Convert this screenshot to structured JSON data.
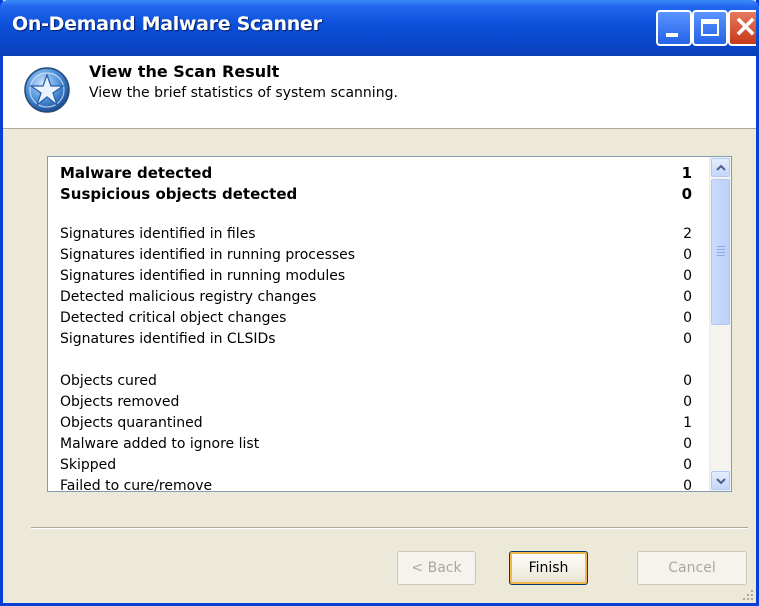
{
  "window": {
    "title": "On-Demand Malware Scanner"
  },
  "header": {
    "title": "View the Scan Result",
    "subtitle": "View the brief statistics of system scanning."
  },
  "stats": {
    "summary": [
      {
        "label": "Malware detected",
        "value": "1"
      },
      {
        "label": "Suspicious objects detected",
        "value": "0"
      }
    ],
    "signatures": [
      {
        "label": "Signatures identified in files",
        "value": "2"
      },
      {
        "label": "Signatures identified in running processes",
        "value": "0"
      },
      {
        "label": "Signatures identified in running modules",
        "value": "0"
      },
      {
        "label": "Detected malicious registry changes",
        "value": "0"
      },
      {
        "label": "Detected critical object changes",
        "value": "0"
      },
      {
        "label": "Signatures identified in CLSIDs",
        "value": "0"
      }
    ],
    "actions": [
      {
        "label": "Objects cured",
        "value": "0"
      },
      {
        "label": "Objects removed",
        "value": "0"
      },
      {
        "label": "Objects quarantined",
        "value": "1"
      },
      {
        "label": "Malware added to ignore list",
        "value": "0"
      },
      {
        "label": "Skipped",
        "value": "0"
      },
      {
        "label": "Failed to cure/remove",
        "value": "0"
      }
    ]
  },
  "buttons": {
    "back": "< Back",
    "finish": "Finish",
    "cancel": "Cancel"
  },
  "colors": {
    "titlebar": "#0a47cc",
    "border": "#0a3fd6",
    "face": "#ece9d8",
    "close": "#c8381c"
  },
  "icons": {
    "header": "star-shield-icon",
    "minimize": "minimize-icon",
    "maximize": "maximize-icon",
    "close": "close-icon",
    "scroll_up": "chevron-up-icon",
    "scroll_down": "chevron-down-icon"
  }
}
